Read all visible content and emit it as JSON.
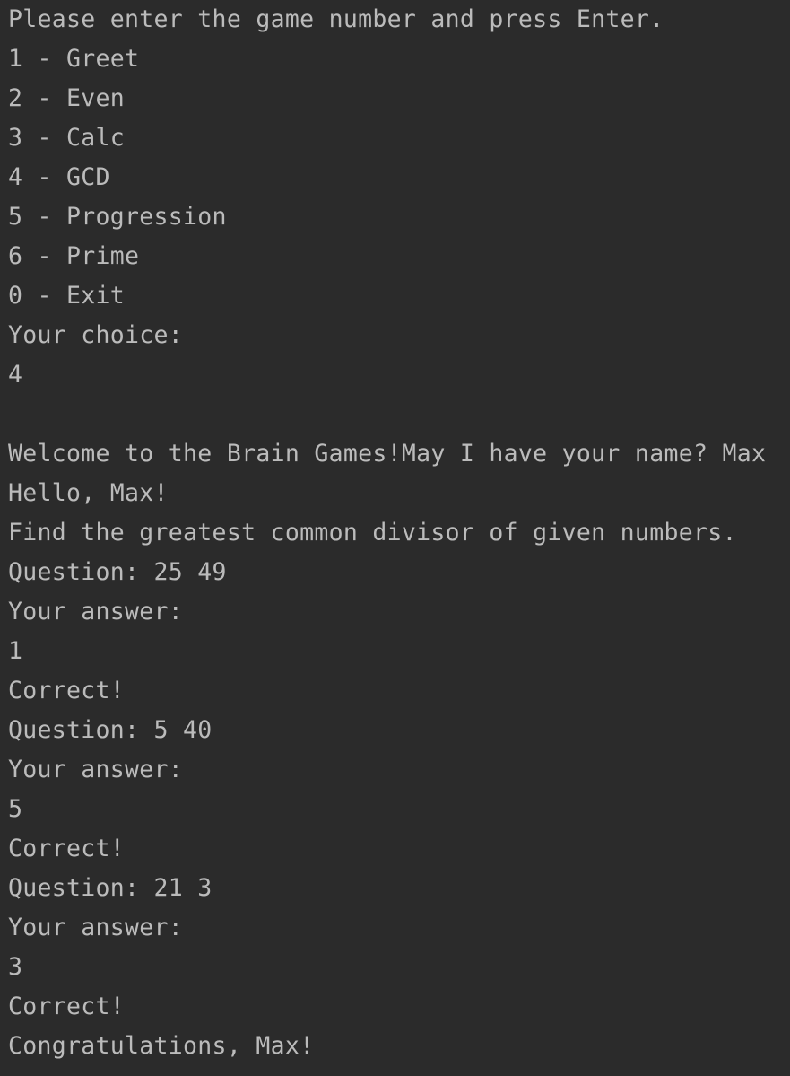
{
  "console": {
    "lines": [
      {
        "text": "Please enter the game number and press Enter.",
        "kind": "output"
      },
      {
        "text": "1 - Greet",
        "kind": "output"
      },
      {
        "text": "2 - Even",
        "kind": "output"
      },
      {
        "text": "3 - Calc",
        "kind": "output"
      },
      {
        "text": "4 - GCD",
        "kind": "output"
      },
      {
        "text": "5 - Progression",
        "kind": "output"
      },
      {
        "text": "6 - Prime",
        "kind": "output"
      },
      {
        "text": "0 - Exit",
        "kind": "output"
      },
      {
        "text": "Your choice:",
        "kind": "output"
      },
      {
        "text": "4",
        "kind": "input"
      },
      {
        "text": "",
        "kind": "blank"
      },
      {
        "text": "Welcome to the Brain Games!May I have your name? Max",
        "kind": "output"
      },
      {
        "text": "Hello, Max!",
        "kind": "output"
      },
      {
        "text": "Find the greatest common divisor of given numbers.",
        "kind": "output"
      },
      {
        "text": "Question: 25 49",
        "kind": "output"
      },
      {
        "text": "Your answer:",
        "kind": "output"
      },
      {
        "text": "1",
        "kind": "input"
      },
      {
        "text": "Correct!",
        "kind": "output"
      },
      {
        "text": "Question: 5 40",
        "kind": "output"
      },
      {
        "text": "Your answer:",
        "kind": "output"
      },
      {
        "text": "5",
        "kind": "input"
      },
      {
        "text": "Correct!",
        "kind": "output"
      },
      {
        "text": "Question: 21 3",
        "kind": "output"
      },
      {
        "text": "Your answer:",
        "kind": "output"
      },
      {
        "text": "3",
        "kind": "input"
      },
      {
        "text": "Correct!",
        "kind": "output"
      },
      {
        "text": "Congratulations, Max!",
        "kind": "output"
      }
    ]
  },
  "colors": {
    "background": "#2b2b2b",
    "text": "#bbbbbb"
  }
}
